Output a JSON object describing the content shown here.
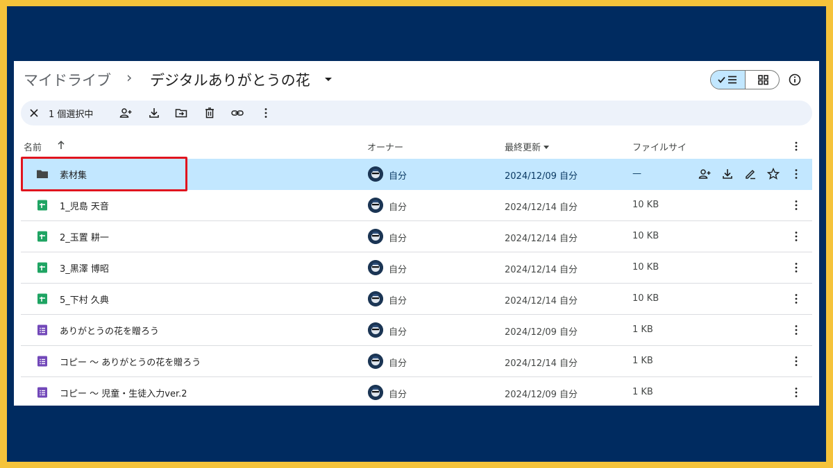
{
  "breadcrumb": {
    "root": "マイドライブ",
    "separator": "›",
    "current": "デジタルありがとうの花"
  },
  "toolbar": {
    "selection_count": "1 個選択中",
    "icons": [
      "close-icon",
      "share-icon",
      "download-icon",
      "move-icon",
      "trash-icon",
      "link-icon",
      "more-vert-icon"
    ]
  },
  "columns": {
    "name": "名前",
    "owner": "オーナー",
    "modified": "最終更新",
    "size": "ファイルサイ"
  },
  "files": [
    {
      "type": "folder",
      "name": "素材集",
      "owner": "自分",
      "modified": "2024/12/09 自分",
      "size": "—",
      "selected": true
    },
    {
      "type": "sheet",
      "name": "1_児島 天音",
      "owner": "自分",
      "modified": "2024/12/14 自分",
      "size": "10 KB"
    },
    {
      "type": "sheet",
      "name": "2_玉置 耕一",
      "owner": "自分",
      "modified": "2024/12/14 自分",
      "size": "10 KB"
    },
    {
      "type": "sheet",
      "name": "3_黒澤 博昭",
      "owner": "自分",
      "modified": "2024/12/14 自分",
      "size": "10 KB"
    },
    {
      "type": "sheet",
      "name": "5_下村 久典",
      "owner": "自分",
      "modified": "2024/12/14 自分",
      "size": "10 KB"
    },
    {
      "type": "form",
      "name": "ありがとうの花を贈ろう",
      "owner": "自分",
      "modified": "2024/12/09 自分",
      "size": "1 KB"
    },
    {
      "type": "form",
      "name": "コピー ～ ありがとうの花を贈ろう",
      "owner": "自分",
      "modified": "2024/12/14 自分",
      "size": "1 KB"
    },
    {
      "type": "form",
      "name": "コピー ～ 児童・生徒入力ver.2",
      "owner": "自分",
      "modified": "2024/12/09 自分",
      "size": "1 KB"
    }
  ],
  "colors": {
    "outer_border": "#F5C33B",
    "frame_bg": "#002B60",
    "selected_row": "#C2E7FF",
    "toolbar_bg": "#EDF2FA",
    "sheet_green": "#1FA463",
    "form_purple": "#7248B9",
    "highlight_red": "#E0141E"
  }
}
